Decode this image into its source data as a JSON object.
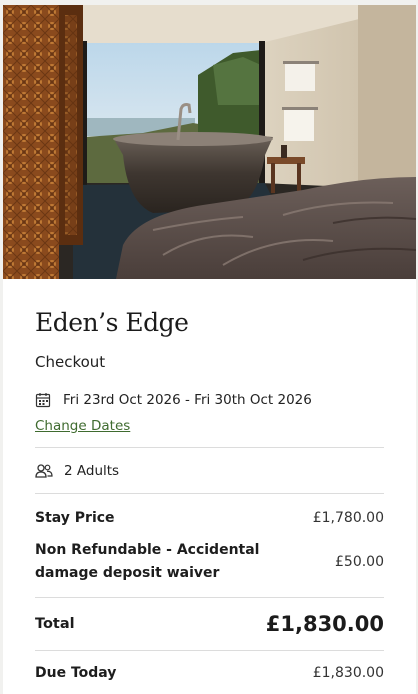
{
  "property": {
    "name": "Eden’s Edge",
    "page_label": "Checkout"
  },
  "hero": {
    "image_icon": "hotel-bathroom-photo"
  },
  "booking": {
    "dates": "Fri 23rd Oct 2026 - Fri 30th Oct 2026",
    "dates_icon": "calendar-icon",
    "change_dates_label": "Change Dates",
    "guests": "2 Adults",
    "guests_icon": "users-icon"
  },
  "pricing": {
    "stay_label": "Stay Price",
    "stay_value": "£1,780.00",
    "waiver_label_line1": "Non Refundable - Accidental",
    "waiver_label_line2": "damage deposit waiver",
    "waiver_value": "£50.00",
    "total_label": "Total",
    "total_value": "£1,830.00",
    "due_label": "Due Today",
    "due_value": "£1,830.00"
  },
  "colors": {
    "link": "#3f6b2f",
    "divider": "#dcdcdc",
    "background": "#f1f1ef"
  }
}
